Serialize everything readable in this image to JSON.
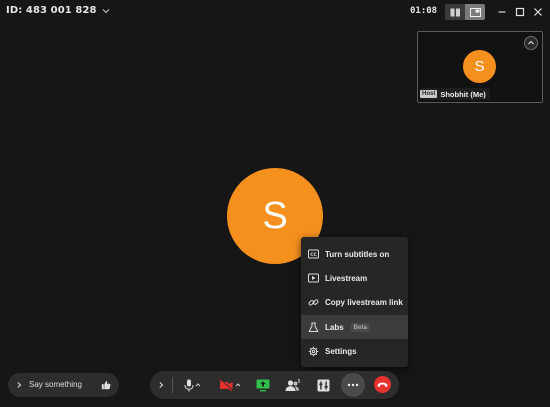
{
  "header": {
    "meeting_id": "ID: 483 001 828",
    "timer": "01:08"
  },
  "self_view": {
    "initial": "S",
    "host_badge": "Host",
    "name": "Shobhit (Me)"
  },
  "main": {
    "initial": "S"
  },
  "menu": {
    "items": [
      {
        "label": "Turn subtitles on",
        "icon": "cc-icon"
      },
      {
        "label": "Livestream",
        "icon": "play-icon"
      },
      {
        "label": "Copy livestream link",
        "icon": "link-icon"
      },
      {
        "label": "Labs",
        "icon": "flask-icon",
        "badge": "Beta",
        "highlighted": true
      },
      {
        "label": "Settings",
        "icon": "gear-icon"
      }
    ]
  },
  "chat": {
    "placeholder": "Say something"
  },
  "colors": {
    "avatar": "#f5901f",
    "end_call": "#e5322d",
    "camera_off": "#e5322d",
    "screen_share": "#2fbf4a",
    "background": "#161616"
  }
}
